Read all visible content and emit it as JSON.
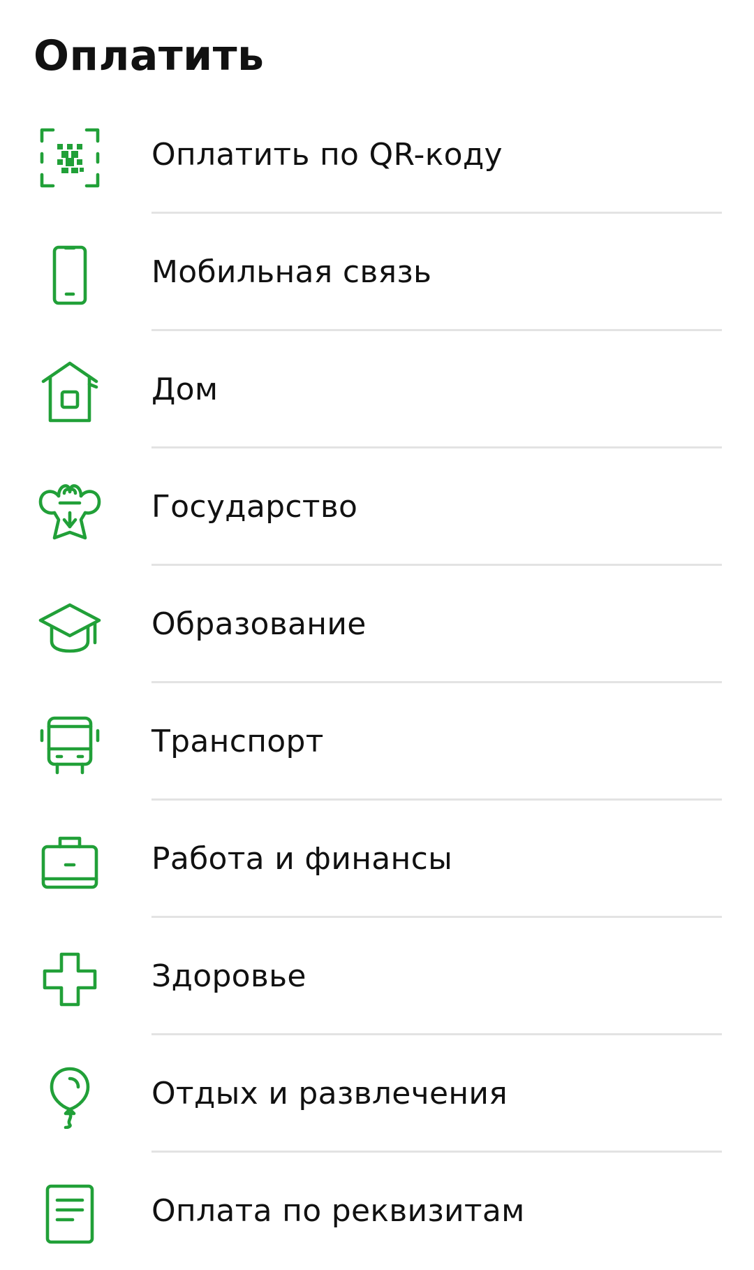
{
  "header": {
    "title": "Оплатить"
  },
  "theme": {
    "accent": "#21A038",
    "divider": "#E3E3E3",
    "text": "#111111"
  },
  "menu": {
    "items": [
      {
        "label": "Оплатить по QR-коду",
        "icon": "qr-code-icon"
      },
      {
        "label": "Мобильная связь",
        "icon": "smartphone-icon"
      },
      {
        "label": "Дом",
        "icon": "house-icon"
      },
      {
        "label": "Государство",
        "icon": "coat-of-arms-icon"
      },
      {
        "label": "Образование",
        "icon": "graduation-cap-icon"
      },
      {
        "label": "Транспорт",
        "icon": "bus-icon"
      },
      {
        "label": "Работа и финансы",
        "icon": "briefcase-icon"
      },
      {
        "label": "Здоровье",
        "icon": "medical-cross-icon"
      },
      {
        "label": "Отдых и развлечения",
        "icon": "balloon-icon"
      },
      {
        "label": "Оплата по реквизитам",
        "icon": "document-icon"
      }
    ]
  }
}
